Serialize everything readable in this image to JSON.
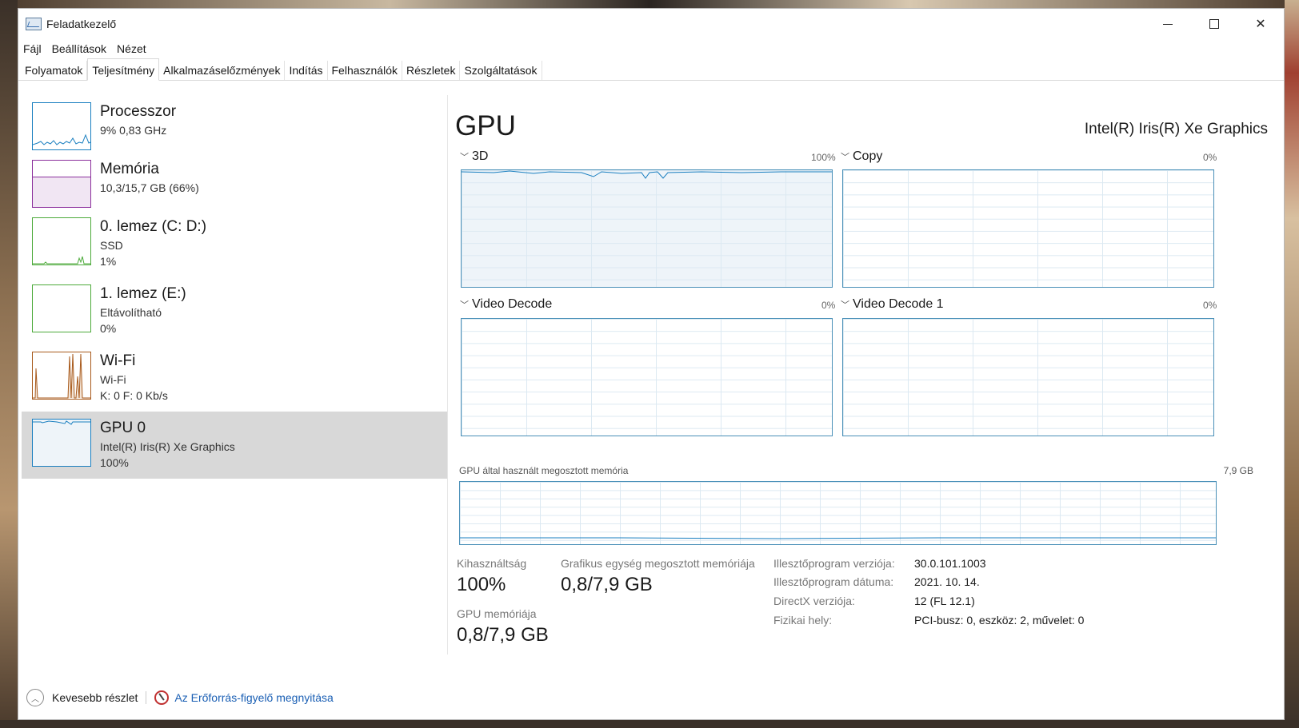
{
  "window": {
    "title": "Feladatkezelő"
  },
  "menu": [
    "Fájl",
    "Beállítások",
    "Nézet"
  ],
  "tabs": [
    "Folyamatok",
    "Teljesítmény",
    "Alkalmazáselőzmények",
    "Indítás",
    "Felhasználók",
    "Részletek",
    "Szolgáltatások"
  ],
  "active_tab": "Teljesítmény",
  "sidebar": {
    "items": [
      {
        "name": "Processzor",
        "line1": "9%  0,83 GHz",
        "line2": "",
        "color": "#1a7fc0"
      },
      {
        "name": "Memória",
        "line1": "10,3/15,7 GB (66%)",
        "line2": "",
        "color": "#8b2f9c"
      },
      {
        "name": "0. lemez (C: D:)",
        "line1": "SSD",
        "line2": "1%",
        "color": "#4caa3a"
      },
      {
        "name": "1. lemez (E:)",
        "line1": "Eltávolítható",
        "line2": "0%",
        "color": "#4caa3a"
      },
      {
        "name": "Wi-Fi",
        "line1": "Wi-Fi",
        "line2": "K: 0  F: 0 Kb/s",
        "color": "#a85a1c"
      },
      {
        "name": "GPU 0",
        "line1": "Intel(R) Iris(R) Xe Graphics",
        "line2": "100%",
        "color": "#1a7fc0"
      }
    ],
    "selected": "GPU 0"
  },
  "main": {
    "title": "GPU",
    "model": "Intel(R) Iris(R) Xe Graphics",
    "graphs": [
      {
        "label": "3D",
        "pct": "100%",
        "level": 1.0
      },
      {
        "label": "Copy",
        "pct": "0%",
        "level": 0
      },
      {
        "label": "Video Decode",
        "pct": "0%",
        "level": 0
      },
      {
        "label": "Video Decode 1",
        "pct": "0%",
        "level": 0
      }
    ],
    "shared_memory": {
      "label": "GPU által használt megosztott memória",
      "max": "7,9 GB"
    },
    "stats": {
      "util_label": "Kihasználtság",
      "util_value": "100%",
      "shared_label": "Grafikus egység megosztott memóriája",
      "shared_value": "0,8/7,9 GB",
      "gpu_mem_label": "GPU memóriája",
      "gpu_mem_value": "0,8/7,9 GB"
    },
    "info": [
      {
        "label": "Illesztőprogram verziója:",
        "value": "30.0.101.1003"
      },
      {
        "label": "Illesztőprogram dátuma:",
        "value": "2021. 10. 14."
      },
      {
        "label": "DirectX verziója:",
        "value": "12 (FL 12.1)"
      },
      {
        "label": "Fizikai hely:",
        "value": "PCI-busz: 0, eszköz: 2, művelet: 0"
      }
    ]
  },
  "footer": {
    "less_details": "Kevesebb részlet",
    "resource_monitor": "Az Erőforrás-figyelő megnyitása"
  },
  "icons": [
    "taskmanager-icon",
    "minimize-icon",
    "maximize-icon",
    "close-icon",
    "chevron-down-icon",
    "chevron-up-icon",
    "resource-monitor-icon"
  ]
}
